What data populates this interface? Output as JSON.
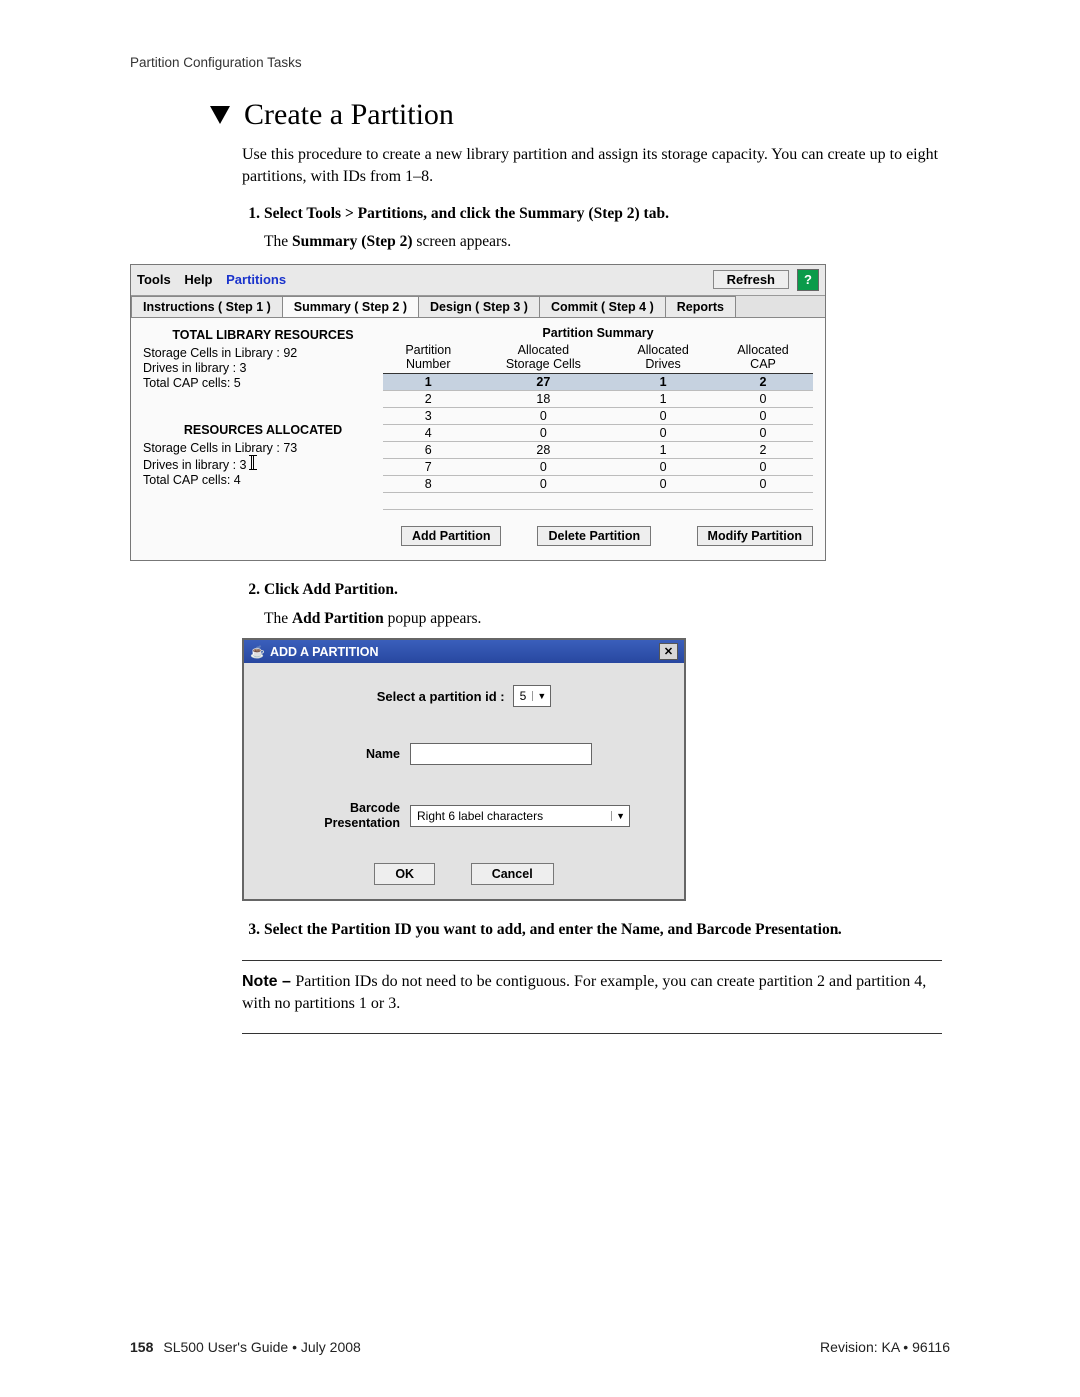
{
  "header_label": "Partition Configuration Tasks",
  "title": "Create a Partition",
  "intro": "Use this procedure to create a new library partition and assign its storage capacity. You can create up to eight partitions, with IDs from 1–8.",
  "step1_bold": "Select Tools > Partitions, and click the Summary (Step 2) tab.",
  "step1_followup_a": "The ",
  "step1_followup_b": "Summary (Step 2)",
  "step1_followup_c": " screen appears.",
  "screenshot": {
    "menu": {
      "tools": "Tools",
      "help": "Help",
      "partitions": "Partitions"
    },
    "refresh": "Refresh",
    "tabs": [
      "Instructions ( Step 1 )",
      "Summary ( Step 2 )",
      "Design ( Step 3 )",
      "Commit ( Step 4 )",
      "Reports"
    ],
    "left": {
      "total_head": "TOTAL LIBRARY RESOURCES",
      "total_lines": [
        "Storage Cells in Library : 92",
        "Drives in library : 3",
        "Total CAP cells: 5"
      ],
      "alloc_head": "RESOURCES ALLOCATED",
      "alloc_lines": [
        "Storage Cells in Library : 73",
        "Drives in library : 3",
        "Total CAP cells: 4"
      ]
    },
    "summary_title": "Partition Summary",
    "cols": [
      "Partition\nNumber",
      "Allocated\nStorage Cells",
      "Allocated\nDrives",
      "Allocated\nCAP"
    ],
    "rows": [
      {
        "n": "1",
        "c": "27",
        "d": "1",
        "cap": "2",
        "sel": true
      },
      {
        "n": "2",
        "c": "18",
        "d": "1",
        "cap": "0"
      },
      {
        "n": "3",
        "c": "0",
        "d": "0",
        "cap": "0"
      },
      {
        "n": "4",
        "c": "0",
        "d": "0",
        "cap": "0"
      },
      {
        "n": "6",
        "c": "28",
        "d": "1",
        "cap": "2"
      },
      {
        "n": "7",
        "c": "0",
        "d": "0",
        "cap": "0"
      },
      {
        "n": "8",
        "c": "0",
        "d": "0",
        "cap": "0"
      }
    ],
    "btns": [
      "Add Partition",
      "Delete Partition",
      "Modify Partition"
    ]
  },
  "step2_bold": "Click Add Partition.",
  "step2_followup_a": "The ",
  "step2_followup_b": "Add Partition",
  "step2_followup_c": " popup appears.",
  "popup": {
    "title": "ADD A PARTITION",
    "id_label": "Select a partition id :",
    "id_value": "5",
    "name_label": "Name",
    "barcode_label": "Barcode\nPresentation",
    "barcode_value": "Right 6 label characters",
    "ok": "OK",
    "cancel": "Cancel"
  },
  "step3_bold": "Select the Partition ID you want to add, and enter the Name, and Barcode Presentation",
  "step3_tail": ".",
  "note_label": "Note – ",
  "note_text": "Partition IDs do not need to be contiguous. For example, you can create partition 2 and partition 4, with no partitions 1 or 3.",
  "footer": {
    "page": "158",
    "left": "SL500 User's Guide • July 2008",
    "right": "Revision: KA • 96116"
  }
}
